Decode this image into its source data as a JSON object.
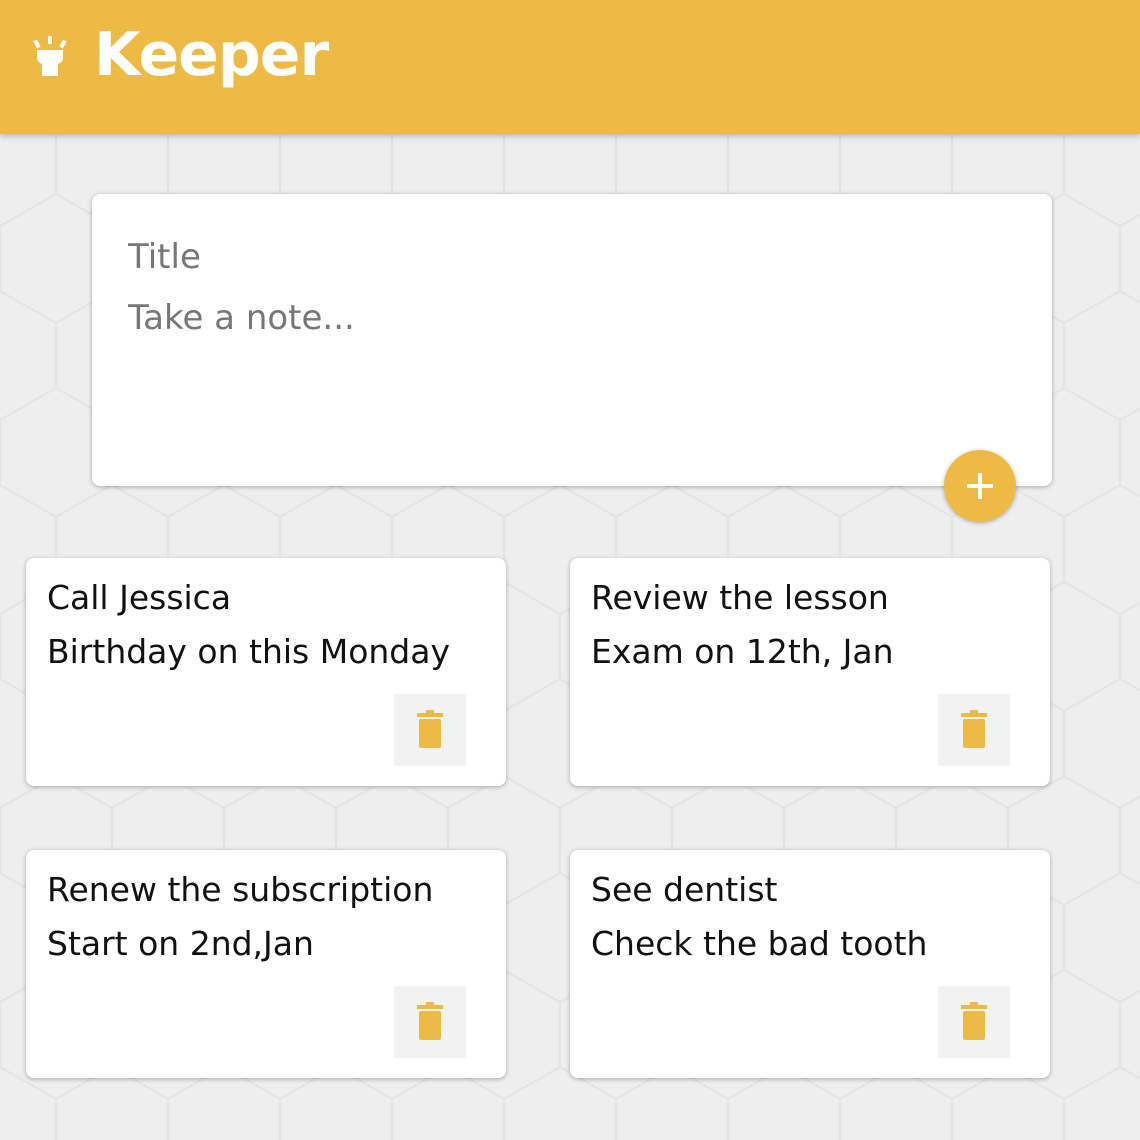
{
  "header": {
    "title": "Keeper",
    "logo_icon": "lightbulb-icon"
  },
  "colors": {
    "accent": "#edba45",
    "background": "#eeeeee",
    "card": "#ffffff"
  },
  "create_note": {
    "title_placeholder": "Title",
    "content_placeholder": "Take a note...",
    "add_icon": "plus-icon"
  },
  "notes": [
    {
      "title": "Call Jessica",
      "content": "Birthday on this Monday"
    },
    {
      "title": "Review the lesson",
      "content": "Exam on 12th, Jan"
    },
    {
      "title": "Renew the subscription",
      "content": "Start on 2nd,Jan"
    },
    {
      "title": "See dentist",
      "content": "Check the bad tooth"
    }
  ],
  "delete_icon": "trash-icon"
}
